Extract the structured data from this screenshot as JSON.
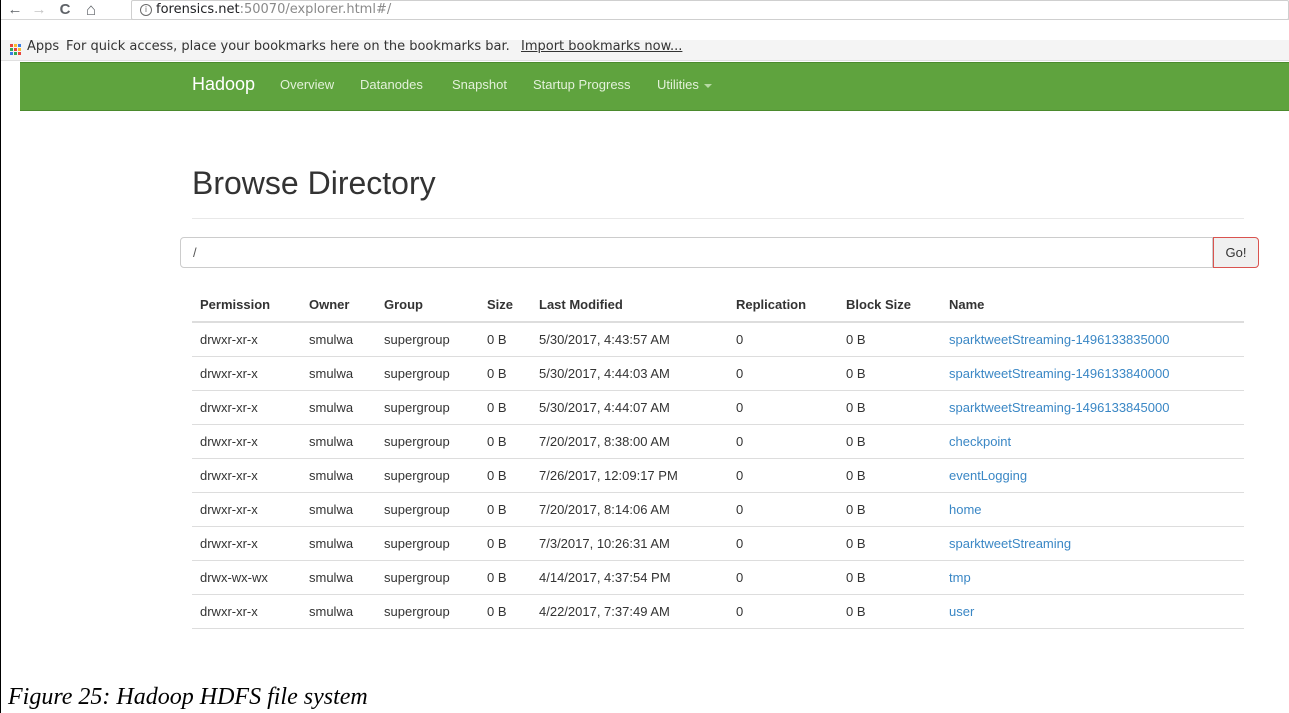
{
  "browser": {
    "back_glyph": "←",
    "forward_glyph": "→",
    "reload_glyph": "C",
    "home_glyph": "⌂",
    "info_glyph": "i",
    "url_host": "forensics.net",
    "url_rest": ":50070/explorer.html#/",
    "bookmarks": {
      "apps_label": "Apps",
      "prompt": "For quick access, place your bookmarks here on the bookmarks bar.",
      "import_link": "Import bookmarks now..."
    }
  },
  "navbar": {
    "brand": "Hadoop",
    "links": [
      "Overview",
      "Datanodes",
      "Snapshot",
      "Startup Progress",
      "Utilities"
    ]
  },
  "page": {
    "title": "Browse Directory",
    "path_value": "/",
    "go_label": "Go!"
  },
  "table": {
    "headers": [
      "Permission",
      "Owner",
      "Group",
      "Size",
      "Last Modified",
      "Replication",
      "Block Size",
      "Name"
    ],
    "rows": [
      [
        "drwxr-xr-x",
        "smulwa",
        "supergroup",
        "0 B",
        "5/30/2017, 4:43:57 AM",
        "0",
        "0 B",
        "sparktweetStreaming-1496133835000"
      ],
      [
        "drwxr-xr-x",
        "smulwa",
        "supergroup",
        "0 B",
        "5/30/2017, 4:44:03 AM",
        "0",
        "0 B",
        "sparktweetStreaming-1496133840000"
      ],
      [
        "drwxr-xr-x",
        "smulwa",
        "supergroup",
        "0 B",
        "5/30/2017, 4:44:07 AM",
        "0",
        "0 B",
        "sparktweetStreaming-1496133845000"
      ],
      [
        "drwxr-xr-x",
        "smulwa",
        "supergroup",
        "0 B",
        "7/20/2017, 8:38:00 AM",
        "0",
        "0 B",
        "checkpoint"
      ],
      [
        "drwxr-xr-x",
        "smulwa",
        "supergroup",
        "0 B",
        "7/26/2017, 12:09:17 PM",
        "0",
        "0 B",
        "eventLogging"
      ],
      [
        "drwxr-xr-x",
        "smulwa",
        "supergroup",
        "0 B",
        "7/20/2017, 8:14:06 AM",
        "0",
        "0 B",
        "home"
      ],
      [
        "drwxr-xr-x",
        "smulwa",
        "supergroup",
        "0 B",
        "7/3/2017, 10:26:31 AM",
        "0",
        "0 B",
        "sparktweetStreaming"
      ],
      [
        "drwx-wx-wx",
        "smulwa",
        "supergroup",
        "0 B",
        "4/14/2017, 4:37:54 PM",
        "0",
        "0 B",
        "tmp"
      ],
      [
        "drwxr-xr-x",
        "smulwa",
        "supergroup",
        "0 B",
        "4/22/2017, 7:37:49 AM",
        "0",
        "0 B",
        "user"
      ]
    ]
  },
  "caption": "Figure 25: Hadoop HDFS file system",
  "colors": {
    "navbar": "#5fa33e",
    "link": "#3a87c5",
    "go_border": "#d9534f"
  }
}
